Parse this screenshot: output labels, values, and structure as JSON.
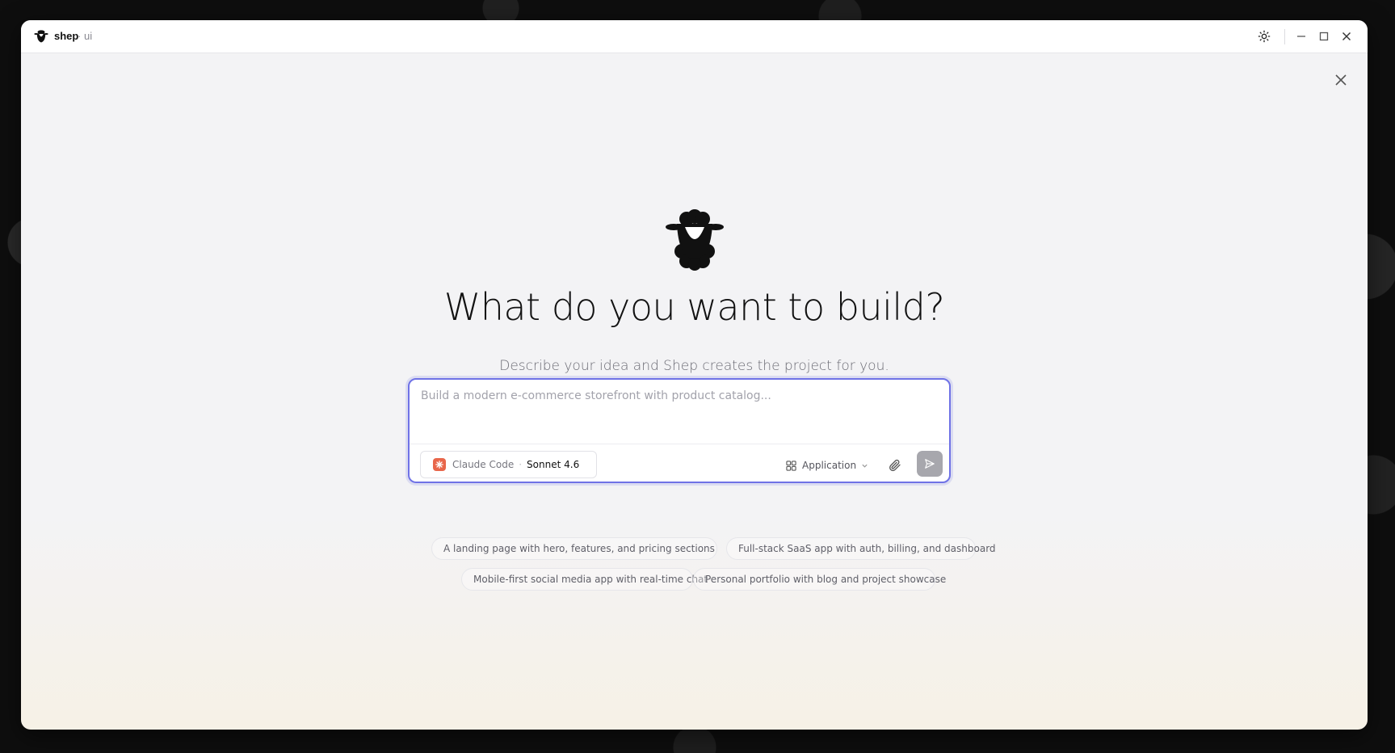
{
  "window": {
    "app_name": "shep",
    "separator": "·",
    "app_sub": "ui"
  },
  "main": {
    "headline": "What do you want to build?",
    "subheadline": "Describe your idea and Shep creates the project for you."
  },
  "composer": {
    "placeholder": "Build a modern e-commerce storefront with product catalog...",
    "value": "",
    "provider": "Claude Code",
    "provider_separator": "·",
    "model": "Sonnet 4.6",
    "project_type": "Application"
  },
  "suggestions": [
    "A landing page with hero, features, and pricing sections",
    "Full-stack SaaS app with auth, billing, and dashboard",
    "Mobile-first social media app with real-time chat",
    "Personal portfolio with blog and project showcase"
  ],
  "icons": {
    "app_logo": "sheep-logo-icon",
    "theme": "sun-icon",
    "minimize": "minimize-icon",
    "maximize": "maximize-icon",
    "close": "close-icon",
    "dialog_close": "close-icon",
    "provider": "claude-icon",
    "project_type": "grid-icon",
    "chevron": "chevron-down-icon",
    "attach": "paperclip-icon",
    "send": "send-icon"
  },
  "colors": {
    "accent_border": "#6f72e6",
    "claude_brand": "#e8664a",
    "send_disabled": "#a7a7ad"
  }
}
